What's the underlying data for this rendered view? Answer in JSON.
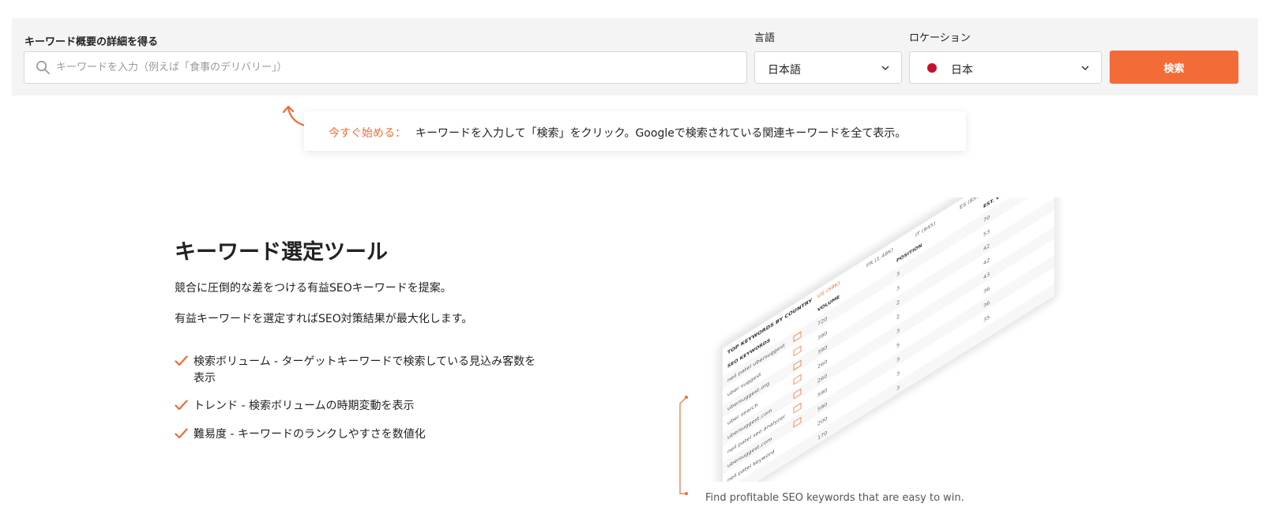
{
  "search_bar": {
    "keyword_label": "キーワード概要の詳細を得る",
    "keyword_placeholder": "キーワードを入力（例えば「食事のデリバリー」）",
    "language_label": "言語",
    "language_value": "日本語",
    "location_label": "ロケーション",
    "location_value": "日本",
    "search_button_label": "検索"
  },
  "tip": {
    "highlight": "今すぐ始める：",
    "message": "キーワードを入力して「検索」をクリック。Googleで検索されている関連キーワードを全て表示。"
  },
  "feature": {
    "title": "キーワード選定ツール",
    "description_1": "競合に圧倒的な差をつける有益SEOキーワードを提案。",
    "description_2": "有益キーワードを選定すればSEO対策結果が最大化します。",
    "items": [
      "検索ボリューム - ターゲットキーワードで検索している見込み客数を表示",
      "トレンド - 検索ボリュームの時期変動を表示",
      "難易度 - キーワードのランクしやすさを数値化"
    ]
  },
  "illustration": {
    "header": "TOP KEYWORDS BY COUNTRY",
    "tabs": [
      "US (59K)",
      "FR (1.48K)",
      "IT (945)",
      "ES (859)",
      "MORE"
    ],
    "columns": [
      "SEO KEYWORDS",
      "VOLUME",
      "POSITION",
      "EST. VISITS"
    ],
    "rows": [
      {
        "keyword": "neil patel ubersuggest",
        "volume": "720",
        "position": "3",
        "visits": "70"
      },
      {
        "keyword": "uber suggest",
        "volume": "390",
        "position": "3",
        "visits": "53"
      },
      {
        "keyword": "ubersuggest.org",
        "volume": "390",
        "position": "2",
        "visits": "42"
      },
      {
        "keyword": "uber search",
        "volume": "260",
        "position": "2",
        "visits": "42"
      },
      {
        "keyword": "ubersuggest.com",
        "volume": "260",
        "position": "3",
        "visits": "43"
      },
      {
        "keyword": "neil patel seo analyzer",
        "volume": "590",
        "position": "5",
        "visits": "36"
      },
      {
        "keyword": "ubersuggest.com",
        "volume": "590",
        "position": "3",
        "visits": "36"
      },
      {
        "keyword": "neil patel keyword",
        "volume": "200",
        "position": "3",
        "visits": "35"
      },
      {
        "keyword": "",
        "volume": "170",
        "position": "3",
        "visits": ""
      }
    ]
  },
  "caption": "Find profitable SEO keywords that are easy to win.",
  "colors": {
    "accent": "#f36b36",
    "panel_bg": "#f4f4f4",
    "flag_red": "#c8102e"
  }
}
